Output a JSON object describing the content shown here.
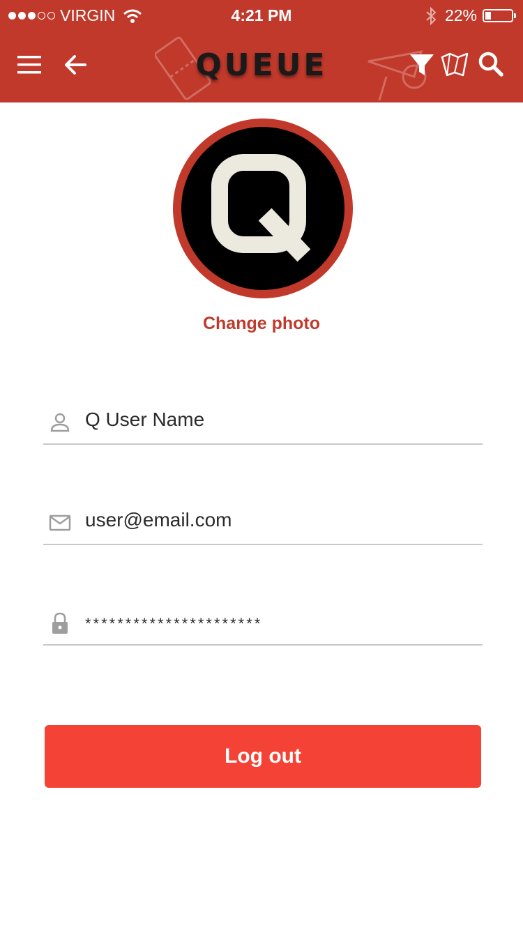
{
  "status_bar": {
    "carrier": "VIRGIN",
    "time": "4:21 PM",
    "battery": "22%",
    "battery_level": 0.22,
    "signal_bars": 3
  },
  "header": {
    "logo": "QUEUE",
    "left_icons": [
      "menu-icon",
      "back-arrow-icon"
    ],
    "right_icons": [
      "filter-icon",
      "map-icon",
      "search-icon"
    ]
  },
  "profile": {
    "avatar_letter": "Q",
    "change_photo": "Change photo"
  },
  "fields": {
    "name": {
      "icon": "person-icon",
      "value": "Q User Name"
    },
    "email": {
      "icon": "mail-icon",
      "value": "user@email.com"
    },
    "password": {
      "icon": "lock-icon",
      "value": "**********************"
    }
  },
  "actions": {
    "logout": "Log out"
  },
  "colors": {
    "header": "#c0392b",
    "accent": "#c0392b",
    "button": "#f44336",
    "avatar_letter": "#ece9df"
  }
}
